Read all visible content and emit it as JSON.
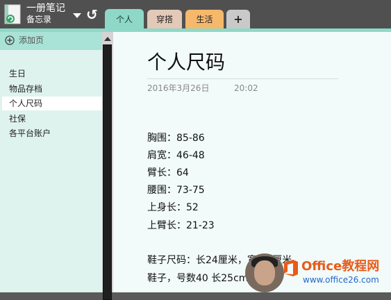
{
  "notebook": {
    "title": "一册笔记",
    "subtitle": "备忘录"
  },
  "tabs": [
    {
      "label": "个人"
    },
    {
      "label": "穿搭"
    },
    {
      "label": "生活"
    },
    {
      "label": "+"
    }
  ],
  "sidebar": {
    "add_page_label": "添加页",
    "items": [
      {
        "label": "生日"
      },
      {
        "label": "物品存档"
      },
      {
        "label": "个人尺码"
      },
      {
        "label": "社保"
      },
      {
        "label": "各平台账户"
      }
    ],
    "selected_index": 2
  },
  "page": {
    "title": "个人尺码",
    "date": "2016年3月26日",
    "time": "20:02",
    "lines": [
      "胸围：85-86",
      "肩宽：46-48",
      "臂长：64",
      "腰围：73-75",
      "上身长：52",
      "上臂长：21-23",
      "鞋子尺码：长24厘米，宽9.2厘米",
      "鞋子，号数40 长25cm"
    ]
  },
  "watermark": {
    "brand": "Office教程网",
    "url": "www.office26.com"
  },
  "colors": {
    "accent_teal": "#8fd8c8",
    "tab_outfit": "#e3c9b8",
    "tab_life": "#f6b86b",
    "topbar": "#505050"
  }
}
